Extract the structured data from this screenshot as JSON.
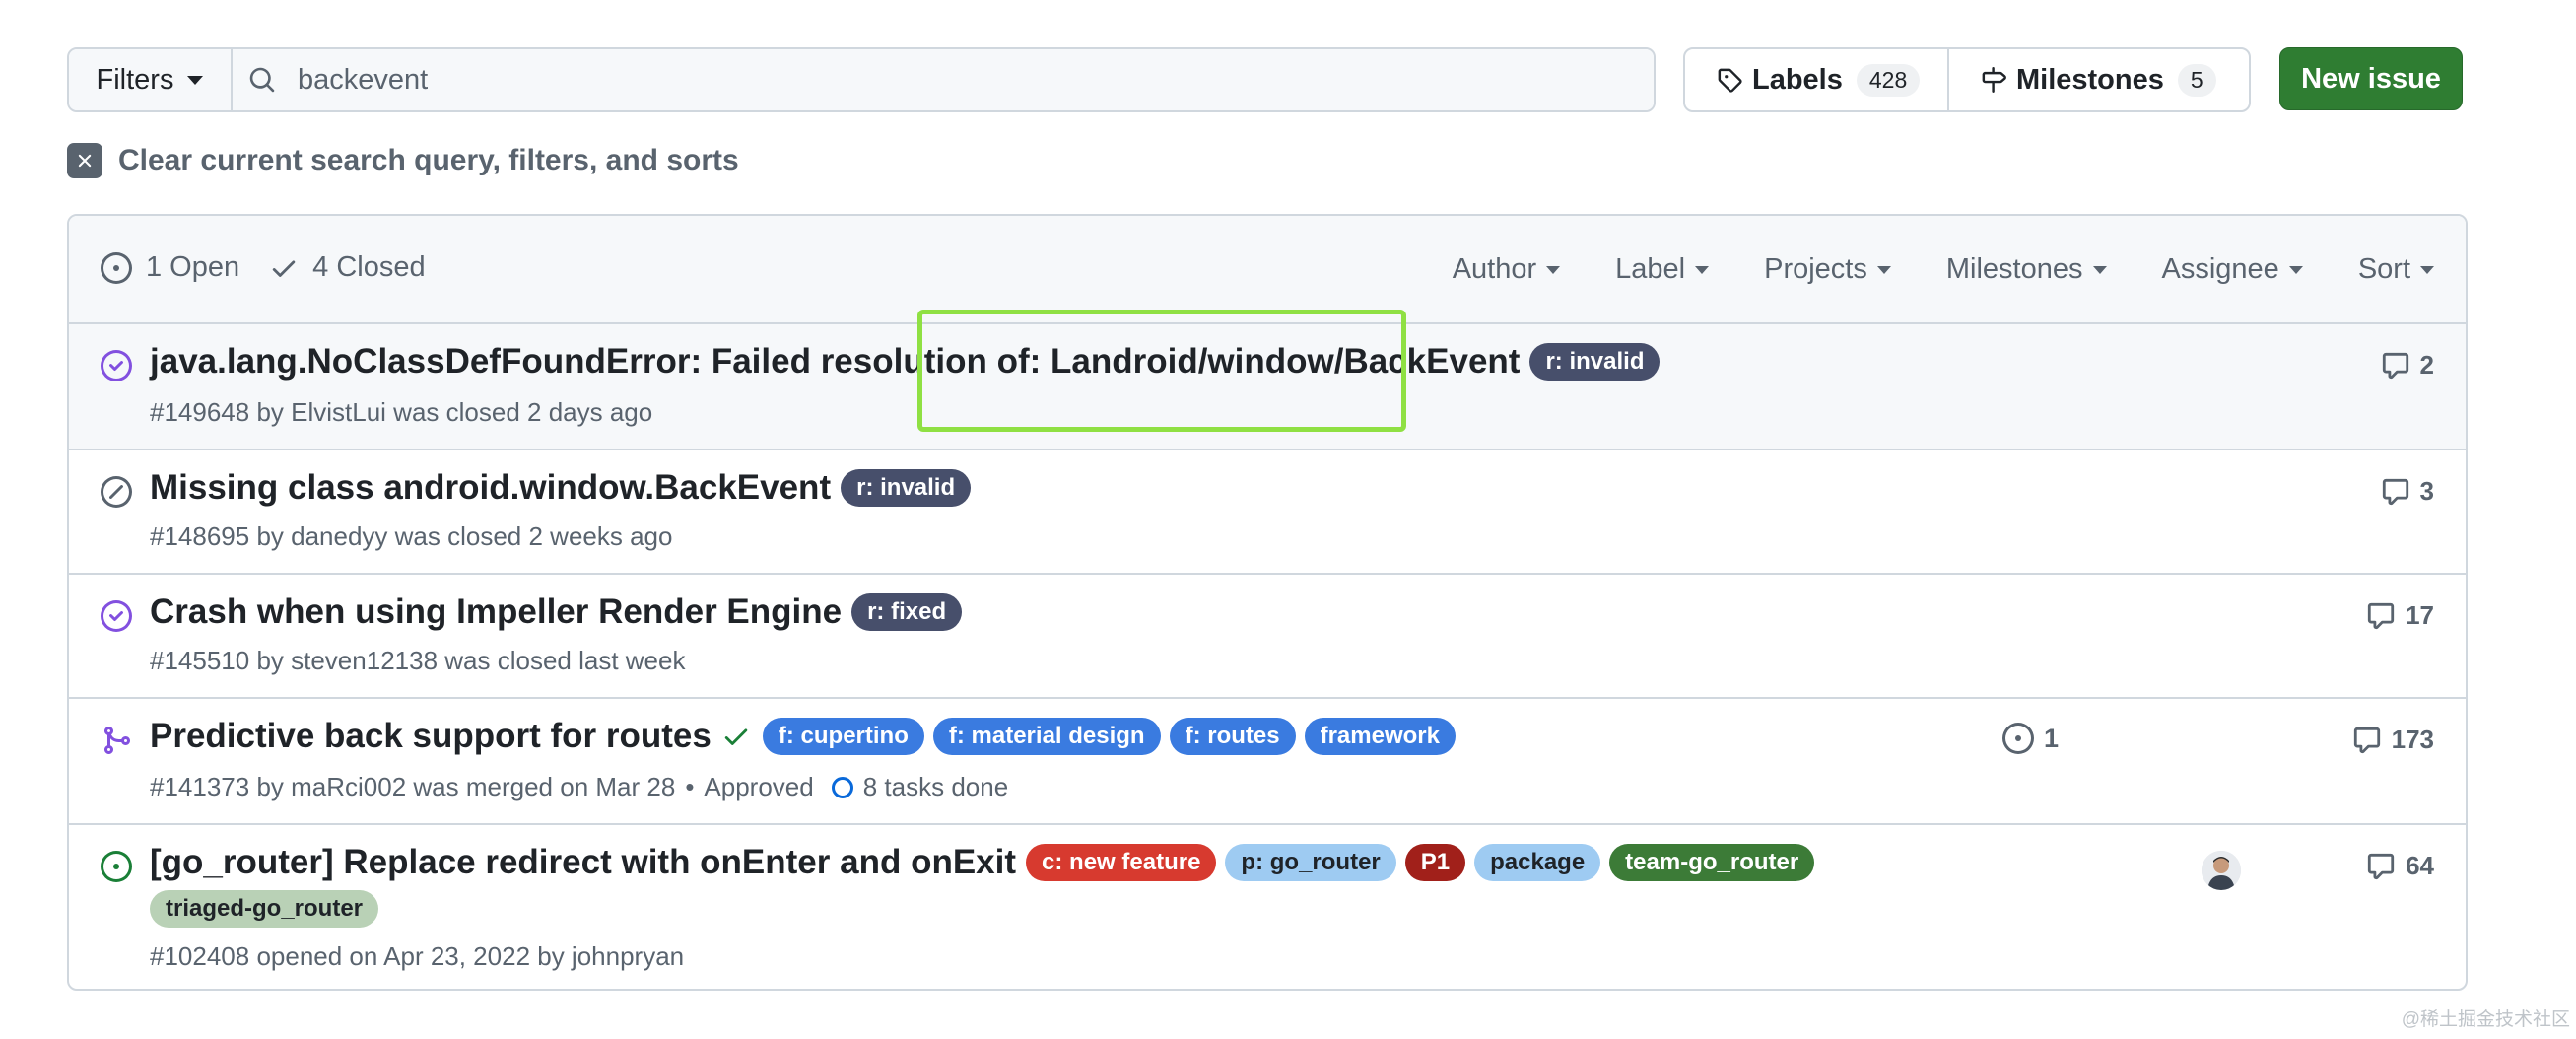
{
  "toolbar": {
    "filters_label": "Filters",
    "search_value": "backevent",
    "labels_label": "Labels",
    "labels_count": "428",
    "milestones_label": "Milestones",
    "milestones_count": "5",
    "new_issue_label": "New issue"
  },
  "clear_query_label": "Clear current search query, filters, and sorts",
  "list_header": {
    "open_label": "1 Open",
    "closed_label": "4 Closed",
    "facets": [
      "Author",
      "Label",
      "Projects",
      "Milestones",
      "Assignee",
      "Sort"
    ]
  },
  "issues": [
    {
      "state": "closed-completed",
      "title": "java.lang.NoClassDefFoundError: Failed resolution of: Landroid/window/BackEvent",
      "labels": [
        {
          "text": "r: invalid",
          "bg": "#474f6b",
          "fg": "#ffffff"
        }
      ],
      "meta": "#149648 by ElvistLui was closed 2 days ago",
      "comments": "2"
    },
    {
      "state": "closed-not-planned",
      "title": "Missing class android.window.BackEvent",
      "labels": [
        {
          "text": "r: invalid",
          "bg": "#474f6b",
          "fg": "#ffffff"
        }
      ],
      "meta": "#148695 by danedyy was closed 2 weeks ago",
      "comments": "3"
    },
    {
      "state": "closed-completed",
      "title": "Crash when using Impeller Render Engine",
      "labels": [
        {
          "text": "r: fixed",
          "bg": "#474f6b",
          "fg": "#ffffff"
        }
      ],
      "meta": "#145510 by steven12138 was closed last week",
      "comments": "17"
    },
    {
      "state": "merged",
      "title": "Predictive back support for routes",
      "labels": [
        {
          "text": "f: cupertino",
          "bg": "#3a7be0",
          "fg": "#ffffff"
        },
        {
          "text": "f: material design",
          "bg": "#3a7be0",
          "fg": "#ffffff"
        },
        {
          "text": "f: routes",
          "bg": "#3a7be0",
          "fg": "#ffffff"
        },
        {
          "text": "framework",
          "bg": "#3a7be0",
          "fg": "#ffffff"
        }
      ],
      "meta": "#141373 by maRci002 was merged on Mar 28",
      "approved": "Approved",
      "tasks": "8 tasks done",
      "linked_count": "1",
      "comments": "173"
    },
    {
      "state": "open",
      "title": "[go_router] Replace redirect with onEnter and onExit",
      "labels": [
        {
          "text": "c: new feature",
          "bg": "#d73a2f",
          "fg": "#ffffff"
        },
        {
          "text": "p: go_router",
          "bg": "#9ecbf2",
          "fg": "#1f2328"
        },
        {
          "text": "P1",
          "bg": "#a1201a",
          "fg": "#ffffff"
        },
        {
          "text": "package",
          "bg": "#9ecbf2",
          "fg": "#1f2328"
        },
        {
          "text": "team-go_router",
          "bg": "#3c7b37",
          "fg": "#ffffff"
        },
        {
          "text": "triaged-go_router",
          "bg": "#b9d1b6",
          "fg": "#1f2328"
        }
      ],
      "meta": "#102408 opened on Apr 23, 2022 by johnpryan",
      "comments": "64"
    }
  ],
  "watermark": "@稀土掘金技术社区",
  "colors": {
    "accent_green": "#2f7d32",
    "closed_purple": "#8250df",
    "open_green": "#1a7f37",
    "muted": "#59636e",
    "highlight": "#8fe043"
  }
}
